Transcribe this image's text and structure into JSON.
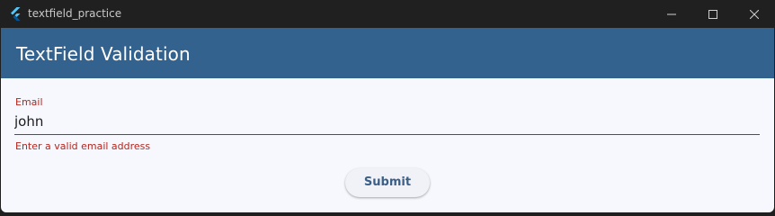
{
  "window": {
    "title": "textfield_practice",
    "app_icon": "flutter-logo-icon",
    "controls": {
      "minimize": "minimize-icon",
      "maximize": "maximize-icon",
      "close": "close-icon"
    }
  },
  "appbar": {
    "title": "TextField Validation",
    "background": "#33628f"
  },
  "form": {
    "email": {
      "label": "Email",
      "value": "john",
      "error": "Enter a valid email address",
      "error_color": "#b3261e"
    },
    "submit_label": "Submit"
  }
}
